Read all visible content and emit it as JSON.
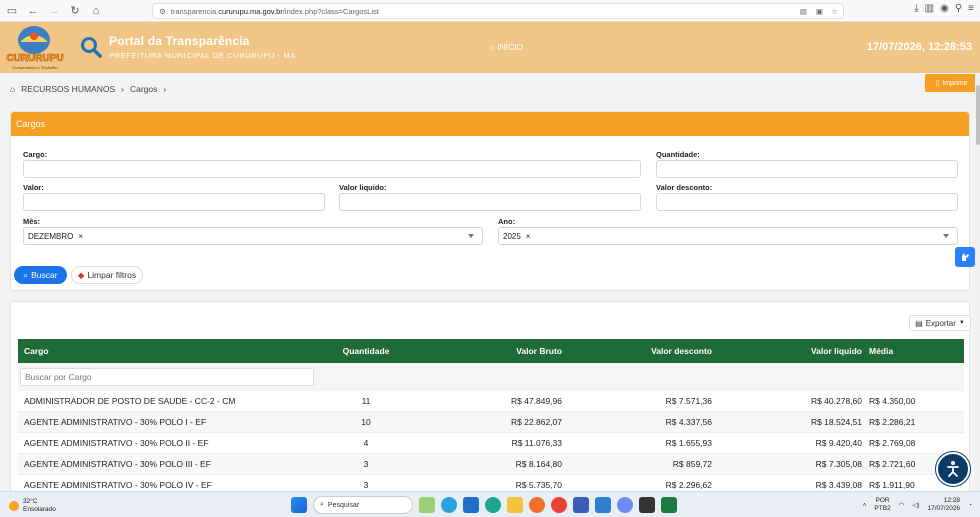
{
  "browser": {
    "url_prefix": "transparencia.",
    "url_domain": "cururupu.ma.gov.br",
    "url_path": "/index.php?class=CargosList"
  },
  "header": {
    "logo_text": "CURURUPU",
    "logo_tagline": "Compromisso e Trabalho",
    "title": "Portal da Transparência",
    "subtitle": "PREFEITURA MUNICIPAL DE CURURUPU - MA",
    "home_label": "INÍCIO",
    "datetime": "17/07/2026, 12:28:53"
  },
  "breadcrumb": {
    "items": [
      "RECURSOS HUMANOS",
      "Cargos"
    ]
  },
  "print_label": "Imprimir",
  "filters": {
    "title": "Cargos",
    "cargo_label": "Cargo:",
    "quantidade_label": "Quantidade:",
    "valor_label": "Valor:",
    "valor_liquido_label": "Valor liquido:",
    "valor_desconto_label": "Valor desconto:",
    "mes_label": "Mês:",
    "mes_value": "DEZEMBRO",
    "ano_label": "Ano:",
    "ano_value": "2025",
    "buscar_label": "Buscar",
    "limpar_label": "Limpar filtros"
  },
  "table": {
    "export_label": "Exportar",
    "search_placeholder": "Buscar por Cargo",
    "columns": [
      "Cargo",
      "Quantidade",
      "Valor Bruto",
      "Valor desconto",
      "Valor liquido",
      "Média"
    ],
    "rows": [
      {
        "cargo": "ADMINISTRADOR DE POSTO DE SAUDE - CC-2 - CM",
        "quantidade": "11",
        "bruto": "R$ 47.849,96",
        "desconto": "R$ 7.571,36",
        "liquido": "R$ 40.278,60",
        "media": "R$ 4.350,00"
      },
      {
        "cargo": "AGENTE ADMINISTRATIVO - 30% POLO I - EF",
        "quantidade": "10",
        "bruto": "R$ 22.862,07",
        "desconto": "R$ 4.337,56",
        "liquido": "R$ 18.524,51",
        "media": "R$ 2.286,21"
      },
      {
        "cargo": "AGENTE ADMINISTRATIVO - 30% POLO II - EF",
        "quantidade": "4",
        "bruto": "R$ 11.076,33",
        "desconto": "R$ 1.655,93",
        "liquido": "R$ 9.420,40",
        "media": "R$ 2.769,08"
      },
      {
        "cargo": "AGENTE ADMINISTRATIVO - 30% POLO III - EF",
        "quantidade": "3",
        "bruto": "R$ 8.164,80",
        "desconto": "R$ 859,72",
        "liquido": "R$ 7.305,08",
        "media": "R$ 2.721,60"
      },
      {
        "cargo": "AGENTE ADMINISTRATIVO - 30% POLO IV - EF",
        "quantidade": "3",
        "bruto": "R$ 5.735,70",
        "desconto": "R$ 2.296,62",
        "liquido": "R$ 3.439,08",
        "media": "R$ 1.911,90"
      }
    ]
  },
  "taskbar": {
    "temperature": "32°C",
    "weather": "Ensolarado",
    "search_label": "Pesquisar",
    "lang_top": "POR",
    "lang_bottom": "PTB2",
    "time": "12:28",
    "date": "17/07/2026"
  },
  "colors": {
    "header_bg": "#f0c585",
    "accent_orange": "#f5a025",
    "table_header": "#1f6b37",
    "primary_blue": "#1a73e8"
  }
}
